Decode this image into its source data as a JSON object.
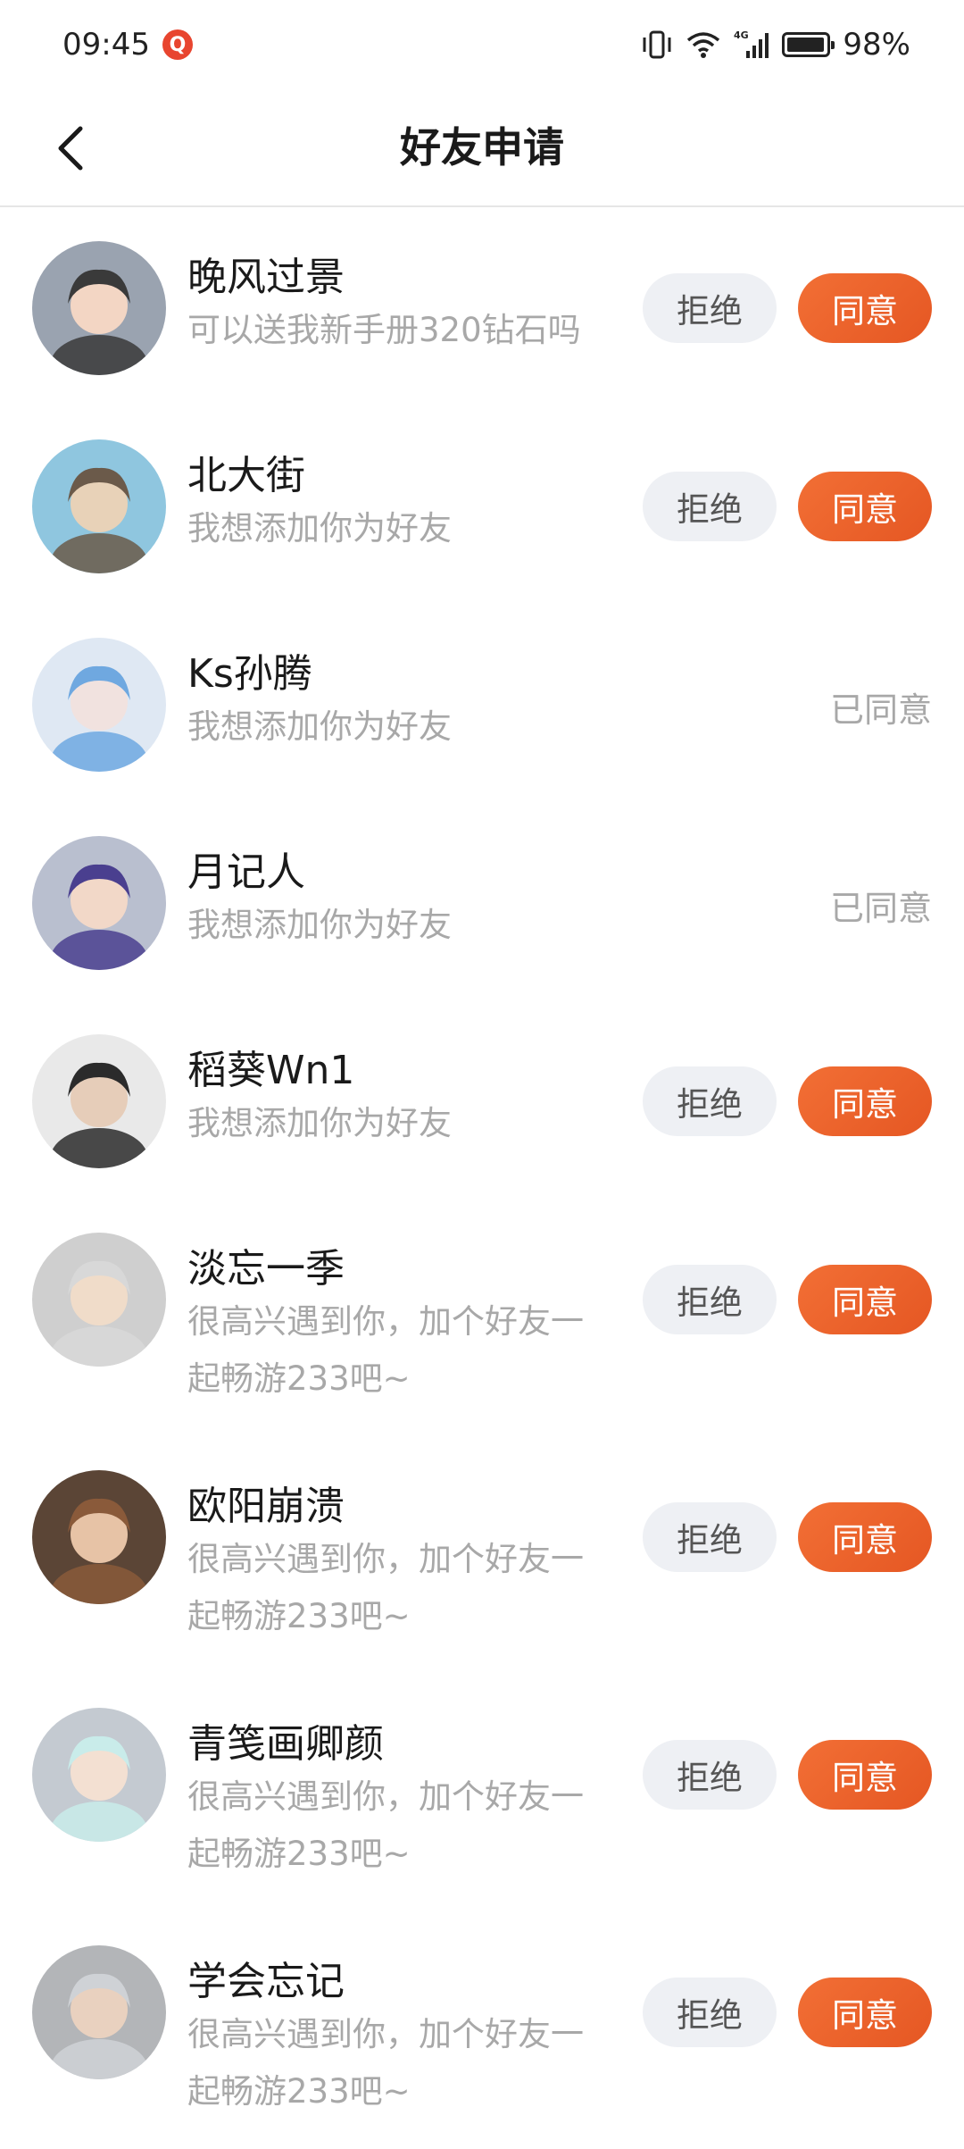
{
  "status_bar": {
    "time": "09:45",
    "notification_badge": "Q",
    "network": "4G",
    "battery": "98%",
    "battery_level": 0.98
  },
  "header": {
    "title": "好友申请"
  },
  "buttons": {
    "reject_label": "拒绝",
    "accept_label": "同意",
    "accepted_label": "已同意"
  },
  "requests": [
    {
      "name": "晚风过景",
      "message": "可以送我新手册320钻石吗",
      "status": "pending"
    },
    {
      "name": "北大街",
      "message": "我想添加你为好友",
      "status": "pending"
    },
    {
      "name": "Ks孙腾",
      "message": "我想添加你为好友",
      "status": "accepted"
    },
    {
      "name": "月记人",
      "message": "我想添加你为好友",
      "status": "accepted"
    },
    {
      "name": "稻葵Wn1",
      "message": "我想添加你为好友",
      "status": "pending"
    },
    {
      "name": "淡忘一季",
      "message": "很高兴遇到你，加个好友一起畅游233吧~",
      "status": "pending"
    },
    {
      "name": "欧阳崩溃",
      "message": "很高兴遇到你，加个好友一起畅游233吧~",
      "status": "pending"
    },
    {
      "name": "青笺画卿颜",
      "message": "很高兴遇到你，加个好友一起畅游233吧~",
      "status": "pending"
    },
    {
      "name": "学会忘记",
      "message": "很高兴遇到你，加个好友一起畅游233吧~",
      "status": "pending"
    }
  ],
  "colors": {
    "accent": "#ea5f2a",
    "reject_bg": "#eef0f4",
    "secondary_text": "#a8a8a8"
  }
}
